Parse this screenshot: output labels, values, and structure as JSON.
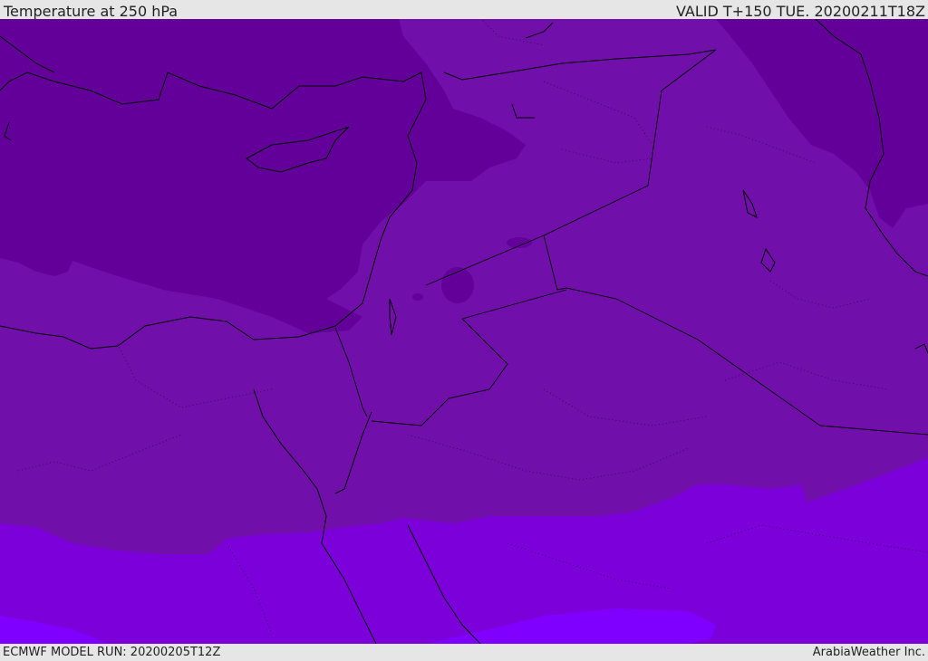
{
  "header": {
    "title": "Temperature at 250 hPa",
    "valid": "VALID T+150 TUE. 20200211T18Z"
  },
  "footer": {
    "model_run": "ECMWF MODEL RUN: 20200205T12Z",
    "brand": "ArabiaWeather Inc."
  },
  "map": {
    "variable": "temperature",
    "level": "250 hPa",
    "colors": {
      "band_coldest": "#63009a",
      "band_cold": "#710fab",
      "band_mid": "#7b00d9",
      "band_warm": "#8000ff",
      "coastline": "#000000",
      "border": "#000000"
    }
  }
}
